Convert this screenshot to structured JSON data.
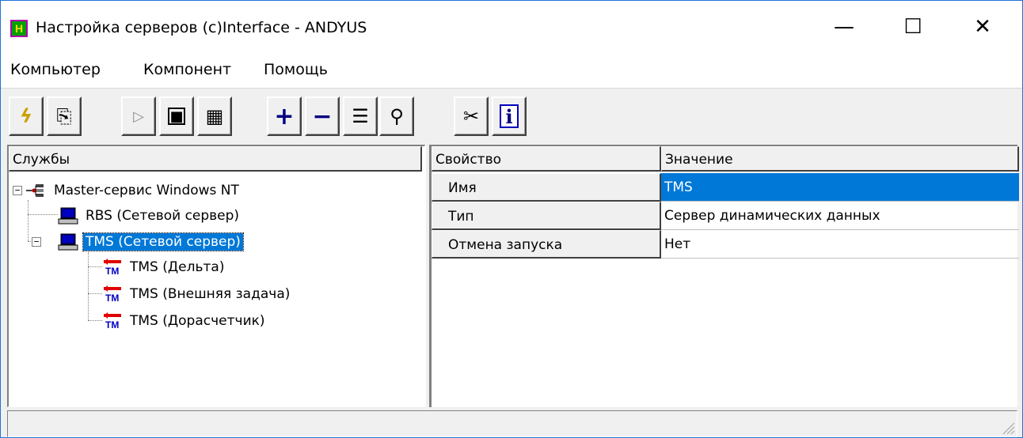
{
  "window": {
    "title": "Настройка серверов (c)Interface - ANDYUS",
    "app_icon_glyph": "H",
    "minimize_glyph": "—",
    "maximize_glyph": "☐",
    "close_glyph": "✕"
  },
  "menu": {
    "items": [
      "Компьютер",
      "Компонент",
      "Помощь"
    ]
  },
  "toolbar": {
    "buttons": [
      {
        "icon": "lightning-icon",
        "glyph": "ϟ"
      },
      {
        "icon": "export-icon",
        "glyph": "⎘"
      },
      {
        "icon": "play-icon",
        "glyph": "▷"
      },
      {
        "icon": "stop-icon",
        "glyph": "■"
      },
      {
        "icon": "stop-all-icon",
        "glyph": "▦"
      },
      {
        "icon": "add-icon",
        "glyph": "+"
      },
      {
        "icon": "remove-icon",
        "glyph": "−"
      },
      {
        "icon": "properties-icon",
        "glyph": "☰"
      },
      {
        "icon": "find-icon",
        "glyph": "⚲"
      },
      {
        "icon": "connect-icon",
        "glyph": "✂"
      },
      {
        "icon": "info-icon",
        "glyph": "i"
      }
    ]
  },
  "tree": {
    "header": "Службы",
    "root": {
      "label": "Master-сервис Windows NT",
      "expander": "−"
    },
    "servers": [
      {
        "label": "RBS (Сетевой сервер)"
      },
      {
        "label": "TMS (Сетевой сервер)",
        "expander": "−",
        "selected": true
      }
    ],
    "children": [
      {
        "label": "TMS (Дельта)"
      },
      {
        "label": "TMS (Внешняя задача)"
      },
      {
        "label": "TMS (Дорасчетчик)"
      }
    ],
    "tm_text": "TM"
  },
  "properties": {
    "header_name": "Свойство",
    "header_value": "Значение",
    "rows": [
      {
        "name": "Имя",
        "value": "TMS",
        "selected": true
      },
      {
        "name": "Тип",
        "value": "Сервер динамических данных"
      },
      {
        "name": "Отмена запуска",
        "value": "Нет"
      }
    ]
  },
  "colors": {
    "selection": "#0078d7",
    "tm_red": "#e00000",
    "tm_blue": "#0000c0"
  }
}
